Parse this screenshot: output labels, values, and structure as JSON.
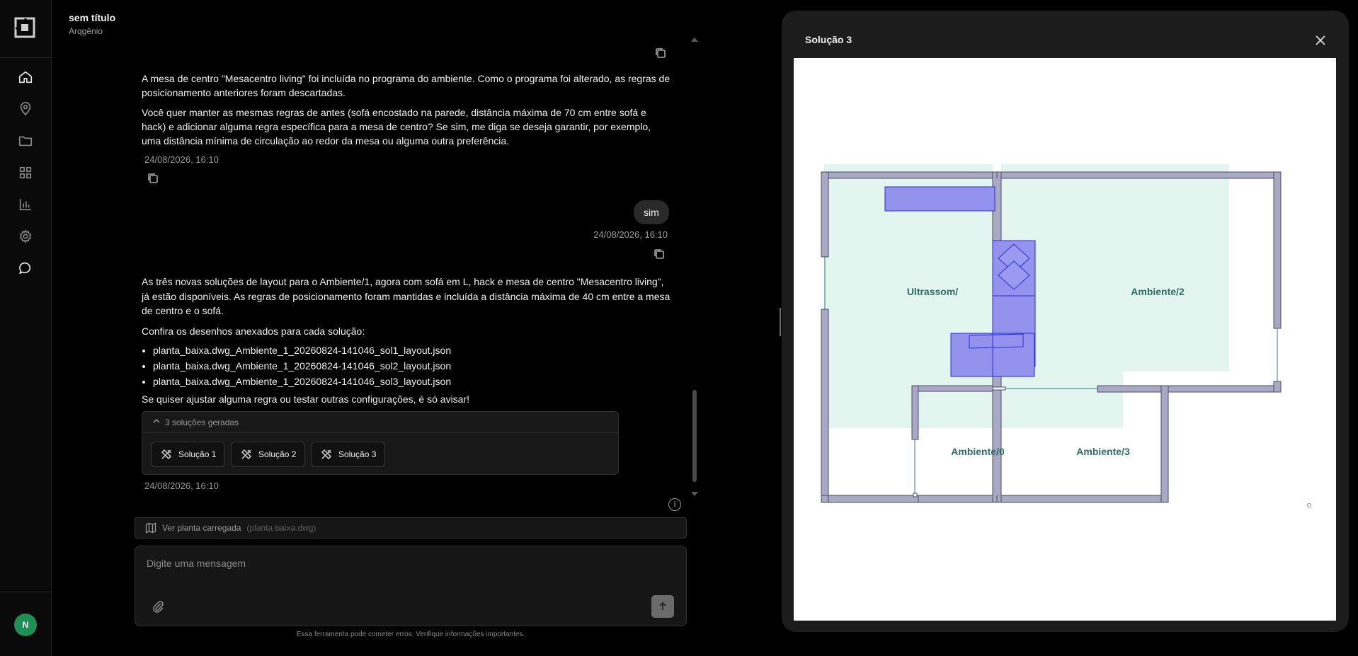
{
  "header": {
    "title": "sem título",
    "subtitle": "Arqgênio"
  },
  "sidebar": {
    "items": [
      {
        "icon": "home-icon"
      },
      {
        "icon": "location-pin-icon"
      },
      {
        "icon": "folder-icon"
      },
      {
        "icon": "grid-icon"
      },
      {
        "icon": "bar-chart-icon"
      },
      {
        "icon": "gear-icon"
      },
      {
        "icon": "chat-bubble-icon"
      }
    ],
    "avatar_initial": "N",
    "avatar_color": "#1f8f55"
  },
  "messages": {
    "assistant_1": {
      "p1": "A mesa de centro \"Mesacentro living\" foi incluída no programa do ambiente. Como o programa foi alterado, as regras de posicionamento anteriores foram descartadas.",
      "p2": "Você quer manter as mesmas regras de antes (sofá encostado na parede, distância máxima de 70 cm entre sofá e hack) e adicionar alguma regra específica para a mesa de centro? Se sim, me diga se deseja garantir, por exemplo, uma distância mínima de circulação ao redor da mesa ou alguma outra preferência.",
      "timestamp": "24/08/2026, 16:10"
    },
    "user_1": {
      "text": "sim",
      "timestamp": "24/08/2026, 16:10"
    },
    "assistant_2": {
      "p1": "As três novas soluções de layout para o Ambiente/1, agora com sofá em L, hack e mesa de centro \"Mesacentro living\", já estão disponíveis. As regras de posicionamento foram mantidas e incluída a distância máxima de 40 cm entre a mesa de centro e o sofá.",
      "p2": "Confira os desenhos anexados para cada solução:",
      "files": [
        "planta_baixa.dwg_Ambiente_1_20260824-141046_sol1_layout.json",
        "planta_baixa.dwg_Ambiente_1_20260824-141046_sol2_layout.json",
        "planta_baixa.dwg_Ambiente_1_20260824-141046_sol3_layout.json"
      ],
      "p3": "Se quiser ajustar alguma regra ou testar outras configurações, é só avisar!",
      "solutions_header": "3 soluções geradas",
      "solutions": [
        "Solução 1",
        "Solução 2",
        "Solução 3"
      ],
      "timestamp": "24/08/2026, 16:10"
    }
  },
  "plan_bar": {
    "label": "Ver planta carregada",
    "file": "(planta baixa.dwg)"
  },
  "composer": {
    "placeholder": "Digite uma mensagem"
  },
  "disclaimer": "Essa ferramenta pode cometer erros. Verifique informações importantes.",
  "panel": {
    "title": "Solução 3",
    "rooms": [
      "Ultrassom/",
      "Ambiente/2",
      "Ambiente/0",
      "Ambiente/3"
    ],
    "colors": {
      "room_fill": "#e2f5ee",
      "wall": "#a9a9c4",
      "furniture": "#9393ee",
      "furniture_stroke": "#2b2bd8",
      "label": "#2f6b6b"
    }
  }
}
